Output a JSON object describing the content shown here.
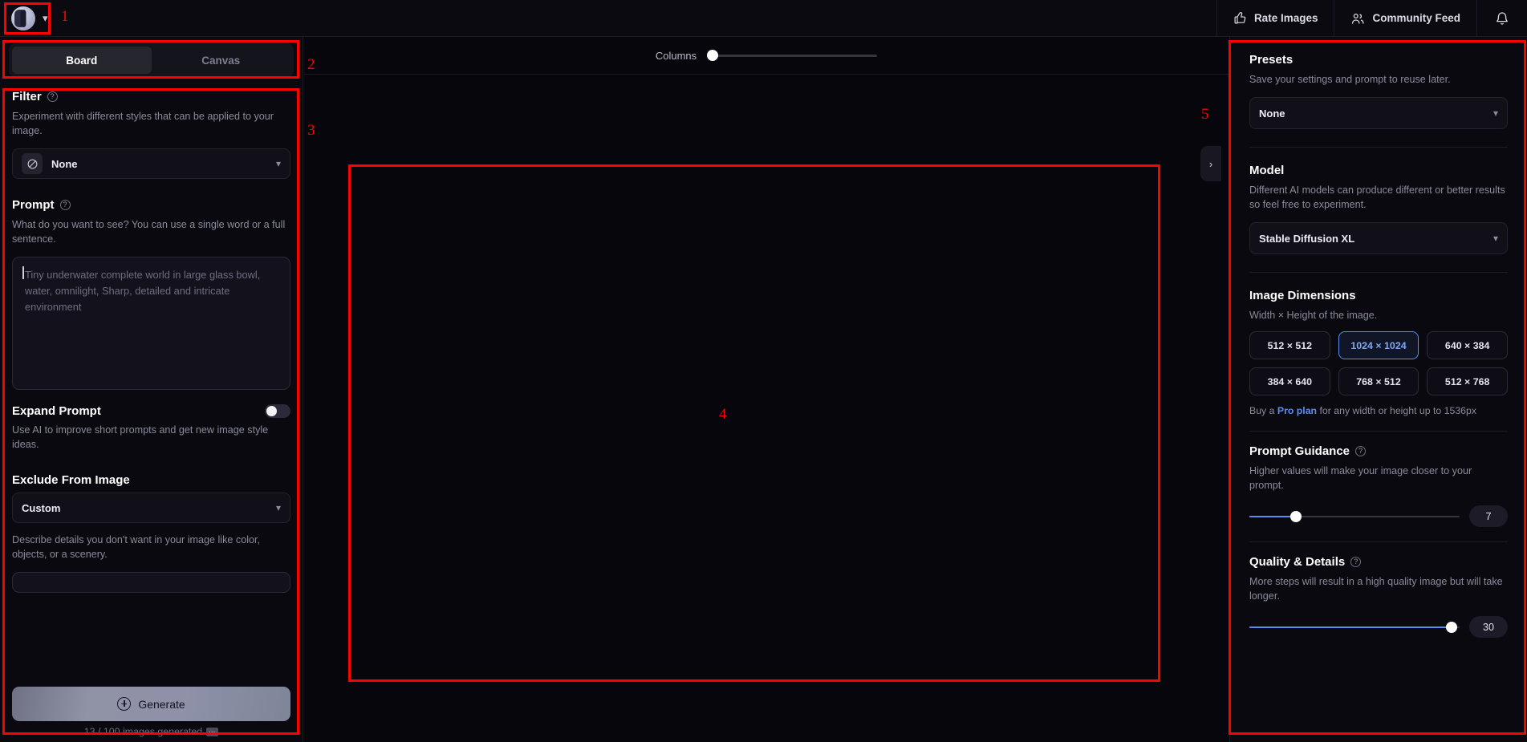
{
  "topbar": {
    "logo_icon": "app-logo-icon",
    "account_chevron": "chevron-down-icon",
    "items": [
      {
        "label": "Rate Images",
        "icon": "thumbs-up-icon"
      },
      {
        "label": "Community Feed",
        "icon": "users-icon"
      }
    ],
    "notifications_icon": "bell-icon"
  },
  "left_panel": {
    "tabs": [
      {
        "label": "Board",
        "active": true
      },
      {
        "label": "Canvas",
        "active": false
      }
    ],
    "filter": {
      "title": "Filter",
      "help_icon": "help-circle-icon",
      "description": "Experiment with different styles that can be applied to your image.",
      "selected": "None",
      "icon": "no-filter-icon",
      "chevron": "chevron-down-icon"
    },
    "prompt": {
      "title": "Prompt",
      "help_icon": "help-circle-icon",
      "description": "What do you want to see? You can use a single word or a full sentence.",
      "value": "",
      "placeholder": "Tiny underwater complete world in large glass bowl, water, omnilight, Sharp, detailed and intricate environment"
    },
    "expand_prompt": {
      "title": "Expand Prompt",
      "description": "Use AI to improve short prompts and get new image style ideas.",
      "enabled": false
    },
    "exclude": {
      "title": "Exclude From Image",
      "selected": "Custom",
      "chevron": "chevron-down-icon",
      "description": "Describe details you don't want in your image like color, objects, or a scenery."
    },
    "generate": {
      "label": "Generate",
      "icon": "plus-circle-icon",
      "caption": "13 / 100 images generated",
      "caption_badge": "…"
    }
  },
  "center": {
    "columns": {
      "label": "Columns",
      "value": 1,
      "min": 1,
      "max": 8,
      "percent": 3
    },
    "collapse_icon": "chevron-right-icon"
  },
  "right_panel": {
    "presets": {
      "title": "Presets",
      "description": "Save your settings and prompt to reuse later.",
      "selected": "None",
      "chevron": "chevron-down-icon"
    },
    "model": {
      "title": "Model",
      "description": "Different AI models can produce different or better results so feel free to experiment.",
      "selected": "Stable Diffusion XL",
      "chevron": "chevron-down-icon"
    },
    "dimensions": {
      "title": "Image Dimensions",
      "description": "Width × Height of the image.",
      "options": [
        {
          "label": "512 × 512",
          "active": false
        },
        {
          "label": "1024 × 1024",
          "active": true
        },
        {
          "label": "640 × 384",
          "active": false
        },
        {
          "label": "384 × 640",
          "active": false
        },
        {
          "label": "768 × 512",
          "active": false
        },
        {
          "label": "512 × 768",
          "active": false
        }
      ],
      "pro_note_before": "Buy a ",
      "pro_link": "Pro plan",
      "pro_note_after": " for any width or height up to 1536px"
    },
    "prompt_guidance": {
      "title": "Prompt Guidance",
      "help_icon": "help-circle-icon",
      "description": "Higher values will make your image closer to your prompt.",
      "value": "7",
      "percent": 22
    },
    "quality": {
      "title": "Quality & Details",
      "help_icon": "help-circle-icon",
      "description": "More steps will result in a high quality image but will take longer.",
      "value": "30",
      "percent": 96
    }
  },
  "annotations": [
    {
      "number": "1"
    },
    {
      "number": "2"
    },
    {
      "number": "3"
    },
    {
      "number": "4"
    },
    {
      "number": "5"
    }
  ],
  "colors": {
    "accent": "#5a8dee",
    "annotation": "#ff0000",
    "background": "#07060b",
    "panel": "#0a0910"
  }
}
